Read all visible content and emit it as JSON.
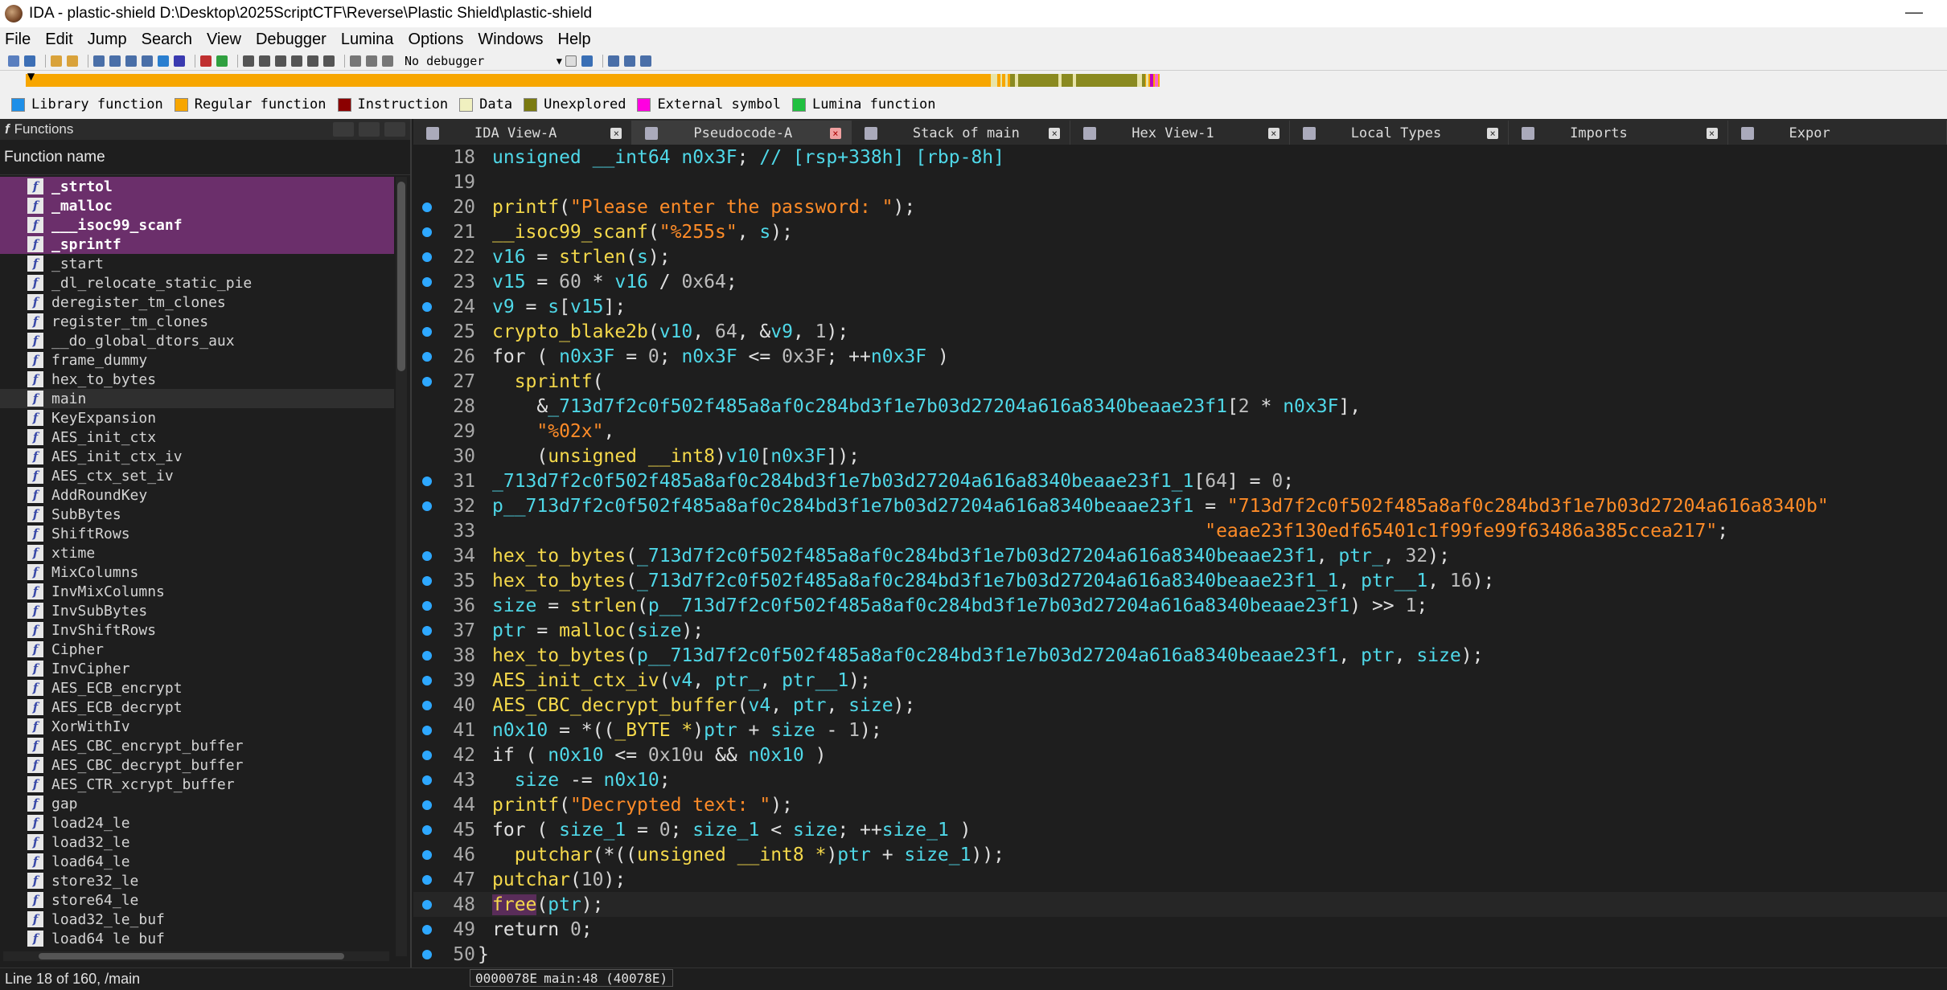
{
  "window": {
    "title": "IDA - plastic-shield D:\\Desktop\\2025ScriptCTF\\Reverse\\Plastic Shield\\plastic-shield",
    "minimize": "—"
  },
  "menu": [
    "File",
    "Edit",
    "Jump",
    "Search",
    "View",
    "Debugger",
    "Lumina",
    "Options",
    "Windows",
    "Help"
  ],
  "toolbar": {
    "debugger_label": "No debugger"
  },
  "legend": [
    {
      "label": "Library function",
      "color": "#1e8fe8"
    },
    {
      "label": "Regular function",
      "color": "#f7a600"
    },
    {
      "label": "Instruction",
      "color": "#8b0000"
    },
    {
      "label": "Data",
      "color": "#f0f0c0"
    },
    {
      "label": "Unexplored",
      "color": "#7a7a10"
    },
    {
      "label": "External symbol",
      "color": "#ff00e0"
    },
    {
      "label": "Lumina function",
      "color": "#20c040"
    }
  ],
  "functions_panel": {
    "title": "Functions",
    "column_header": "Function name",
    "items": [
      {
        "name": "_strtol",
        "style": "hl"
      },
      {
        "name": "_malloc",
        "style": "hl"
      },
      {
        "name": "___isoc99_scanf",
        "style": "hl"
      },
      {
        "name": "_sprintf",
        "style": "hl"
      },
      {
        "name": "_start",
        "style": ""
      },
      {
        "name": "_dl_relocate_static_pie",
        "style": ""
      },
      {
        "name": "deregister_tm_clones",
        "style": ""
      },
      {
        "name": "register_tm_clones",
        "style": ""
      },
      {
        "name": "__do_global_dtors_aux",
        "style": ""
      },
      {
        "name": "frame_dummy",
        "style": ""
      },
      {
        "name": "hex_to_bytes",
        "style": ""
      },
      {
        "name": "main",
        "style": "sel"
      },
      {
        "name": "KeyExpansion",
        "style": ""
      },
      {
        "name": "AES_init_ctx",
        "style": ""
      },
      {
        "name": "AES_init_ctx_iv",
        "style": ""
      },
      {
        "name": "AES_ctx_set_iv",
        "style": ""
      },
      {
        "name": "AddRoundKey",
        "style": ""
      },
      {
        "name": "SubBytes",
        "style": ""
      },
      {
        "name": "ShiftRows",
        "style": ""
      },
      {
        "name": "xtime",
        "style": ""
      },
      {
        "name": "MixColumns",
        "style": ""
      },
      {
        "name": "InvMixColumns",
        "style": ""
      },
      {
        "name": "InvSubBytes",
        "style": ""
      },
      {
        "name": "InvShiftRows",
        "style": ""
      },
      {
        "name": "Cipher",
        "style": ""
      },
      {
        "name": "InvCipher",
        "style": ""
      },
      {
        "name": "AES_ECB_encrypt",
        "style": ""
      },
      {
        "name": "AES_ECB_decrypt",
        "style": ""
      },
      {
        "name": "XorWithIv",
        "style": ""
      },
      {
        "name": "AES_CBC_encrypt_buffer",
        "style": ""
      },
      {
        "name": "AES_CBC_decrypt_buffer",
        "style": ""
      },
      {
        "name": "AES_CTR_xcrypt_buffer",
        "style": ""
      },
      {
        "name": "gap",
        "style": ""
      },
      {
        "name": "load24_le",
        "style": ""
      },
      {
        "name": "load32_le",
        "style": ""
      },
      {
        "name": "load64_le",
        "style": ""
      },
      {
        "name": "store32_le",
        "style": ""
      },
      {
        "name": "store64_le",
        "style": ""
      },
      {
        "name": "load32_le_buf",
        "style": ""
      },
      {
        "name": "load64 le buf",
        "style": ""
      }
    ]
  },
  "tabs": [
    {
      "label": "IDA View-A",
      "active": false
    },
    {
      "label": "Pseudocode-A",
      "active": true
    },
    {
      "label": "Stack of main",
      "active": false
    },
    {
      "label": "Hex View-1",
      "active": false
    },
    {
      "label": "Local Types",
      "active": false
    },
    {
      "label": "Imports",
      "active": false
    },
    {
      "label": "Expor",
      "active": false
    }
  ],
  "code_lines": [
    {
      "n": "18",
      "bp": false,
      "html": "<span class=\"c\">unsigned __int64 n0x3F</span>; <span class=\"c\">// [rsp+338h] [rbp-8h]</span>"
    },
    {
      "n": "19",
      "bp": false,
      "html": ""
    },
    {
      "n": "20",
      "bp": true,
      "html": "<span class=\"k\">printf</span>(<span class=\"s\">\"Please enter the password: \"</span>);"
    },
    {
      "n": "21",
      "bp": true,
      "html": "<span class=\"k\">__isoc99_scanf</span>(<span class=\"s\">\"%255s\"</span>, <span class=\"c\">s</span>);"
    },
    {
      "n": "22",
      "bp": true,
      "html": "<span class=\"c\">v16</span> = <span class=\"k\">strlen</span>(<span class=\"c\">s</span>);"
    },
    {
      "n": "23",
      "bp": true,
      "html": "<span class=\"c\">v15</span> = <span class=\"g\">60</span> * <span class=\"c\">v16</span> / <span class=\"g\">0x64</span>;"
    },
    {
      "n": "24",
      "bp": true,
      "html": "<span class=\"c\">v9</span> = <span class=\"c\">s</span>[<span class=\"c\">v15</span>];"
    },
    {
      "n": "25",
      "bp": true,
      "html": "<span class=\"k\">crypto_blake2b</span>(<span class=\"c\">v10</span>, <span class=\"g\">64</span>, &amp;<span class=\"c\">v9</span>, <span class=\"g\">1</span>);"
    },
    {
      "n": "26",
      "bp": true,
      "html": "for ( <span class=\"c\">n0x3F</span> = <span class=\"g\">0</span>; <span class=\"c\">n0x3F</span> &lt;= <span class=\"g\">0x3F</span>; ++<span class=\"c\">n0x3F</span> )"
    },
    {
      "n": "27",
      "bp": true,
      "html": "  <span class=\"k\">sprintf</span>("
    },
    {
      "n": "28",
      "bp": false,
      "html": "    &amp;<span class=\"c\">_713d7f2c0f502f485a8af0c284bd3f1e7b03d27204a616a8340beaae23f1</span>[<span class=\"g\">2</span> * <span class=\"c\">n0x3F</span>],"
    },
    {
      "n": "29",
      "bp": false,
      "html": "    <span class=\"s\">\"%02x\"</span>,"
    },
    {
      "n": "30",
      "bp": false,
      "html": "    (<span class=\"k\">unsigned __int8</span>)<span class=\"c\">v10</span>[<span class=\"c\">n0x3F</span>]);"
    },
    {
      "n": "31",
      "bp": true,
      "html": "<span class=\"c\">_713d7f2c0f502f485a8af0c284bd3f1e7b03d27204a616a8340beaae23f1_1</span>[<span class=\"g\">64</span>] = <span class=\"g\">0</span>;"
    },
    {
      "n": "32",
      "bp": true,
      "html": "<span class=\"c\">p__713d7f2c0f502f485a8af0c284bd3f1e7b03d27204a616a8340beaae23f1</span> = <span class=\"s\">\"713d7f2c0f502f485a8af0c284bd3f1e7b03d27204a616a8340b\"</span>"
    },
    {
      "n": "33",
      "bp": false,
      "html": "                                                                <span class=\"s\">\"eaae23f130edf65401c1f99fe99f63486a385ccea217\"</span>;"
    },
    {
      "n": "34",
      "bp": true,
      "html": "<span class=\"k\">hex_to_bytes</span>(<span class=\"c\">_713d7f2c0f502f485a8af0c284bd3f1e7b03d27204a616a8340beaae23f1</span>, <span class=\"c\">ptr_</span>, <span class=\"g\">32</span>);"
    },
    {
      "n": "35",
      "bp": true,
      "html": "<span class=\"k\">hex_to_bytes</span>(<span class=\"c\">_713d7f2c0f502f485a8af0c284bd3f1e7b03d27204a616a8340beaae23f1_1</span>, <span class=\"c\">ptr__1</span>, <span class=\"g\">16</span>);"
    },
    {
      "n": "36",
      "bp": true,
      "html": "<span class=\"c\">size</span> = <span class=\"k\">strlen</span>(<span class=\"c\">p__713d7f2c0f502f485a8af0c284bd3f1e7b03d27204a616a8340beaae23f1</span>) &gt;&gt; <span class=\"g\">1</span>;"
    },
    {
      "n": "37",
      "bp": true,
      "html": "<span class=\"c\">ptr</span> = <span class=\"k\">malloc</span>(<span class=\"c\">size</span>);"
    },
    {
      "n": "38",
      "bp": true,
      "html": "<span class=\"k\">hex_to_bytes</span>(<span class=\"c\">p__713d7f2c0f502f485a8af0c284bd3f1e7b03d27204a616a8340beaae23f1</span>, <span class=\"c\">ptr</span>, <span class=\"c\">size</span>);"
    },
    {
      "n": "39",
      "bp": true,
      "html": "<span class=\"k\">AES_init_ctx_iv</span>(<span class=\"c\">v4</span>, <span class=\"c\">ptr_</span>, <span class=\"c\">ptr__1</span>);"
    },
    {
      "n": "40",
      "bp": true,
      "html": "<span class=\"k\">AES_CBC_decrypt_buffer</span>(<span class=\"c\">v4</span>, <span class=\"c\">ptr</span>, <span class=\"c\">size</span>);"
    },
    {
      "n": "41",
      "bp": true,
      "html": "<span class=\"c\">n0x10</span> = *((<span class=\"k\">_BYTE *</span>)<span class=\"c\">ptr</span> + <span class=\"c\">size</span> - <span class=\"g\">1</span>);"
    },
    {
      "n": "42",
      "bp": true,
      "html": "if ( <span class=\"c\">n0x10</span> &lt;= <span class=\"g\">0x10u</span> &amp;&amp; <span class=\"c\">n0x10</span> )"
    },
    {
      "n": "43",
      "bp": true,
      "html": "  <span class=\"c\">size</span> -= <span class=\"c\">n0x10</span>;"
    },
    {
      "n": "44",
      "bp": true,
      "html": "<span class=\"k\">printf</span>(<span class=\"s\">\"Decrypted text: \"</span>);"
    },
    {
      "n": "45",
      "bp": true,
      "html": "for ( <span class=\"c\">size_1</span> = <span class=\"g\">0</span>; <span class=\"c\">size_1</span> &lt; <span class=\"c\">size</span>; ++<span class=\"c\">size_1</span> )"
    },
    {
      "n": "46",
      "bp": true,
      "html": "  <span class=\"k\">putchar</span>(*((<span class=\"k\">unsigned __int8 *</span>)<span class=\"c\">ptr</span> + <span class=\"c\">size_1</span>));"
    },
    {
      "n": "47",
      "bp": true,
      "html": "<span class=\"k\">putchar</span>(<span class=\"g\">10</span>);"
    },
    {
      "n": "48",
      "bp": true,
      "cur": true,
      "html": "<span class=\"k hl-free\">free</span>(<span class=\"c\">ptr</span>);"
    },
    {
      "n": "49",
      "bp": true,
      "html": "return <span class=\"g\">0</span>;"
    },
    {
      "n": "50",
      "bp": true,
      "html": "<span style=\"margin-left:-18px\">}</span>"
    }
  ],
  "status": {
    "line_info": "Line 18 of 160, /main",
    "address": "0000078E",
    "location": "main:48 (40078E)"
  }
}
